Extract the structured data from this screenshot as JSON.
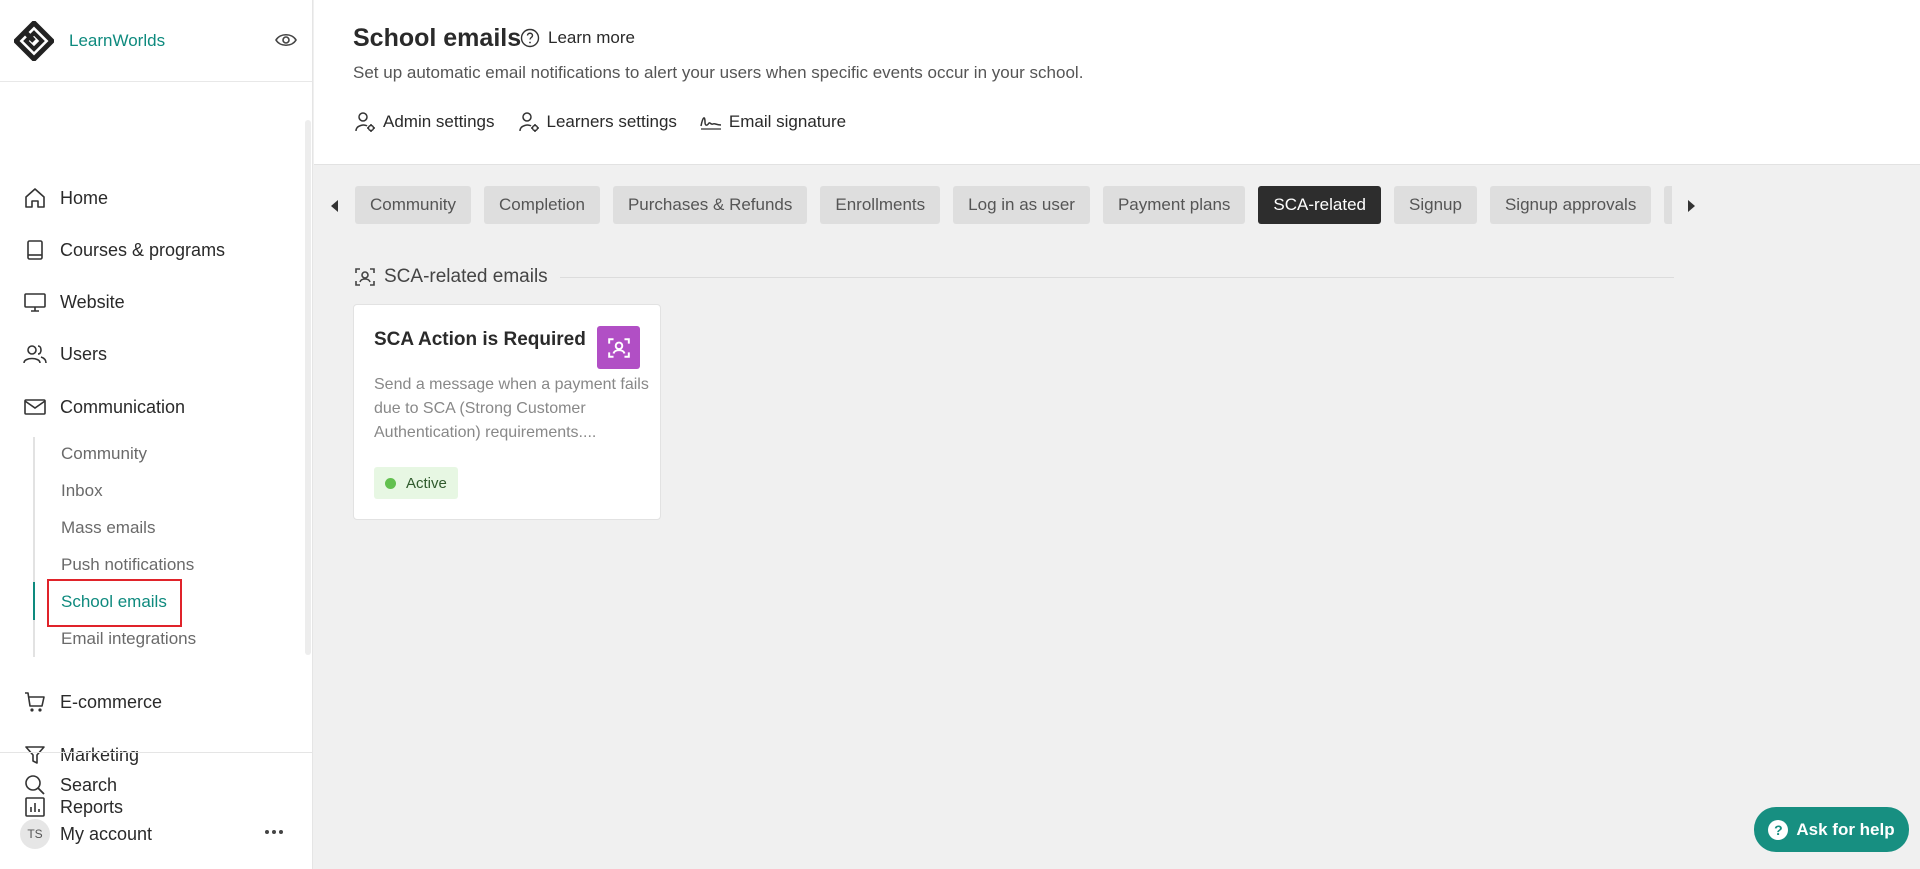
{
  "brand": {
    "name": "LearnWorlds"
  },
  "nav": {
    "items": [
      {
        "label": "Home",
        "icon": "home-icon"
      },
      {
        "label": "Courses & programs",
        "icon": "book-icon"
      },
      {
        "label": "Website",
        "icon": "monitor-icon"
      },
      {
        "label": "Users",
        "icon": "users-icon"
      },
      {
        "label": "Communication",
        "icon": "envelope-icon"
      },
      {
        "label": "E-commerce",
        "icon": "cart-icon"
      },
      {
        "label": "Marketing",
        "icon": "funnel-icon"
      },
      {
        "label": "Reports",
        "icon": "chart-icon"
      },
      {
        "label": "Search",
        "icon": "search-icon"
      },
      {
        "label": "My account",
        "icon": "avatar"
      }
    ],
    "communication_sub": [
      {
        "label": "Community"
      },
      {
        "label": "Inbox"
      },
      {
        "label": "Mass emails"
      },
      {
        "label": "Push notifications"
      },
      {
        "label": "School emails",
        "active": true
      },
      {
        "label": "Email integrations"
      }
    ],
    "avatar_initials": "TS"
  },
  "header": {
    "title": "School emails",
    "learn_more": "Learn more",
    "subtitle": "Set up automatic email notifications to alert your users when specific events occur in your school.",
    "settings": [
      {
        "label": "Admin settings",
        "icon": "user-gear-icon"
      },
      {
        "label": "Learners settings",
        "icon": "user-gear-icon"
      },
      {
        "label": "Email signature",
        "icon": "signature-icon"
      }
    ]
  },
  "tabs": [
    {
      "label": "Community"
    },
    {
      "label": "Completion"
    },
    {
      "label": "Purchases & Refunds"
    },
    {
      "label": "Enrollments"
    },
    {
      "label": "Log in as user"
    },
    {
      "label": "Payment plans"
    },
    {
      "label": "SCA-related",
      "active": true
    },
    {
      "label": "Signup"
    },
    {
      "label": "Signup approvals"
    },
    {
      "label": ""
    }
  ],
  "section": {
    "title": "SCA-related emails"
  },
  "card": {
    "title": "SCA Action is Required",
    "description": "Send a message when a payment fails due to SCA (Strong Customer Authentication) requirements....",
    "status": "Active",
    "icon_color": "#b14fc5",
    "status_color": "#62c04f"
  },
  "help": {
    "label": "Ask for help"
  },
  "colors": {
    "accent": "#0e8a7e",
    "active_tab": "#2d2d2d",
    "help_button": "#178f81"
  }
}
